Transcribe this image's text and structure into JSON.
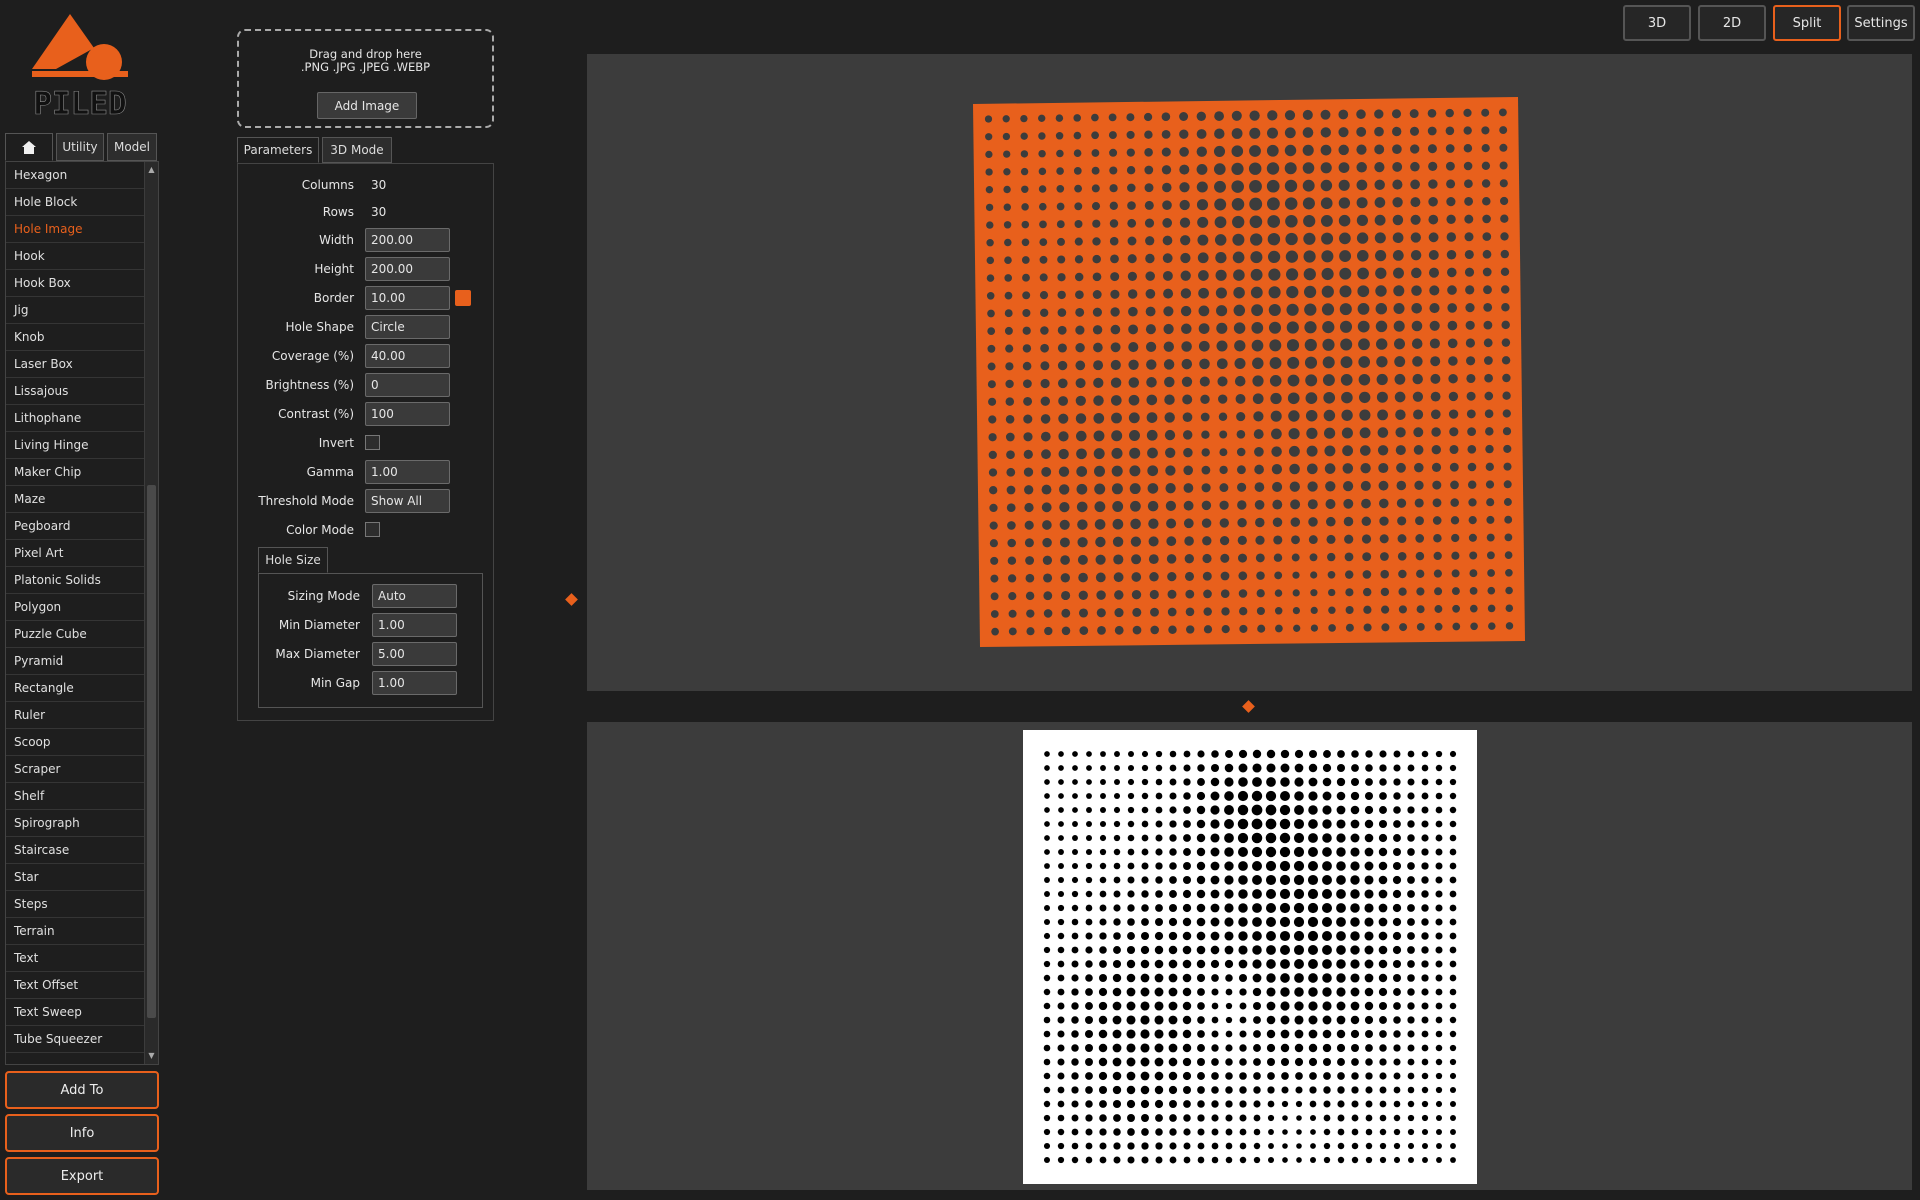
{
  "app": {
    "logo_text": "PILED",
    "accent_color": "#e8601c"
  },
  "left_tabs": {
    "home_icon": "home-icon",
    "utility": "Utility",
    "model": "Model"
  },
  "model_list": {
    "selected": "Hole Image",
    "items": [
      "Hexagon",
      "Hole Block",
      "Hole Image",
      "Hook",
      "Hook Box",
      "Jig",
      "Knob",
      "Laser Box",
      "Lissajous",
      "Lithophane",
      "Living Hinge",
      "Maker Chip",
      "Maze",
      "Pegboard",
      "Pixel Art",
      "Platonic Solids",
      "Polygon",
      "Puzzle Cube",
      "Pyramid",
      "Rectangle",
      "Ruler",
      "Scoop",
      "Scraper",
      "Shelf",
      "Spirograph",
      "Staircase",
      "Star",
      "Steps",
      "Terrain",
      "Text",
      "Text Offset",
      "Text Sweep",
      "Tube Squeezer"
    ]
  },
  "actions": {
    "add_to": "Add To",
    "info": "Info",
    "export": "Export"
  },
  "drop_zone": {
    "line1": "Drag and drop here",
    "line2": ".PNG .JPG .JPEG .WEBP",
    "button": "Add Image"
  },
  "param_tabs": {
    "parameters": "Parameters",
    "mode_3d": "3D Mode"
  },
  "params": {
    "columns": {
      "label": "Columns",
      "value": "30"
    },
    "rows": {
      "label": "Rows",
      "value": "30"
    },
    "width": {
      "label": "Width",
      "value": "200.00"
    },
    "height": {
      "label": "Height",
      "value": "200.00"
    },
    "border": {
      "label": "Border",
      "value": "10.00"
    },
    "hole_shape": {
      "label": "Hole Shape",
      "value": "Circle"
    },
    "coverage": {
      "label": "Coverage (%)",
      "value": "40.00"
    },
    "brightness": {
      "label": "Brightness (%)",
      "value": "0"
    },
    "contrast": {
      "label": "Contrast (%)",
      "value": "100"
    },
    "invert": {
      "label": "Invert"
    },
    "gamma": {
      "label": "Gamma",
      "value": "1.00"
    },
    "threshold_mode": {
      "label": "Threshold Mode",
      "value": "Show All"
    },
    "color_mode": {
      "label": "Color Mode"
    }
  },
  "hole_size": {
    "tab": "Hole Size",
    "sizing_mode": {
      "label": "Sizing Mode",
      "value": "Auto"
    },
    "min_diameter": {
      "label": "Min Diameter",
      "value": "1.00"
    },
    "max_diameter": {
      "label": "Max Diameter",
      "value": "5.00"
    },
    "min_gap": {
      "label": "Min Gap",
      "value": "1.00"
    }
  },
  "view_modes": {
    "btn_3d": "3D",
    "btn_2d": "2D",
    "btn_split": "Split",
    "btn_settings": "Settings",
    "active": "Split"
  },
  "preview": {
    "grid_columns": 30,
    "grid_rows": 30,
    "plate_color": "#e8601c",
    "hole_color_3d": "#3c3c3c",
    "background_2d": "#ffffff",
    "hole_color_2d": "#000000"
  }
}
